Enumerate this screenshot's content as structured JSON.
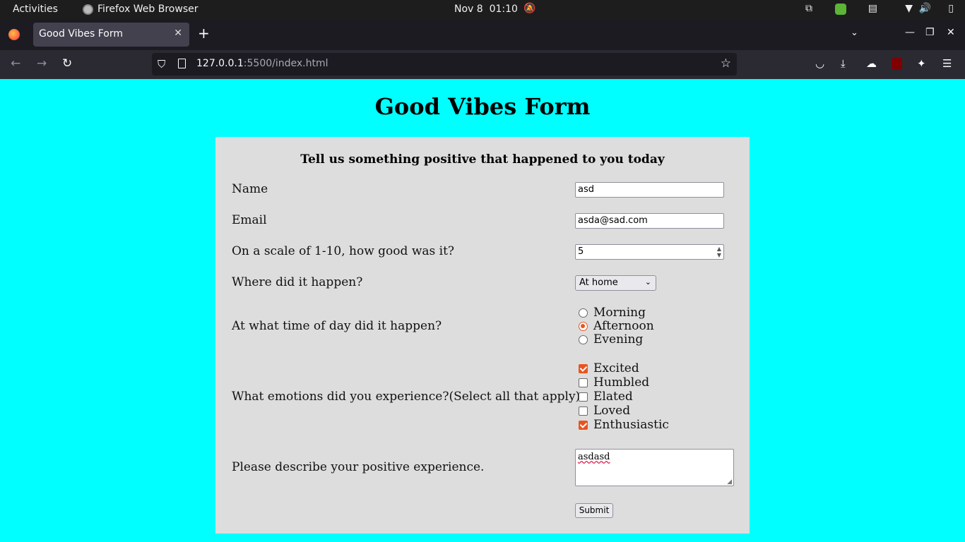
{
  "system_bar": {
    "activities": "Activities",
    "app_name": "Firefox Web Browser",
    "date": "Nov 8",
    "time": "01:10"
  },
  "browser": {
    "tab_title": "Good Vibes Form",
    "url_host": "127.0.0.1",
    "url_rest": ":5500/index.html"
  },
  "page": {
    "title": "Good Vibes Form",
    "subtitle": "Tell us something positive that happened to you today",
    "fields": {
      "name": {
        "label": "Name",
        "value": "asd"
      },
      "email": {
        "label": "Email",
        "value": "asda@sad.com"
      },
      "scale": {
        "label": "On a scale of 1-10, how good was it?",
        "value": "5"
      },
      "where": {
        "label": "Where did it happen?",
        "selected": "At home"
      },
      "time_of_day": {
        "label": "At what time of day did it happen?",
        "options": [
          {
            "label": "Morning",
            "checked": false
          },
          {
            "label": "Afternoon",
            "checked": true
          },
          {
            "label": "Evening",
            "checked": false
          }
        ]
      },
      "emotions": {
        "label": "What emotions did you experience?(Select all that apply)",
        "options": [
          {
            "label": "Excited",
            "checked": true
          },
          {
            "label": "Humbled",
            "checked": false
          },
          {
            "label": "Elated",
            "checked": false
          },
          {
            "label": "Loved",
            "checked": false
          },
          {
            "label": "Enthusiastic",
            "checked": true
          }
        ]
      },
      "description": {
        "label": "Please describe your positive experience.",
        "value": "asdasd"
      }
    },
    "submit_label": "Submit"
  },
  "colors": {
    "page_bg": "#00ffff",
    "form_bg": "#dddddd",
    "accent": "#e95420"
  }
}
